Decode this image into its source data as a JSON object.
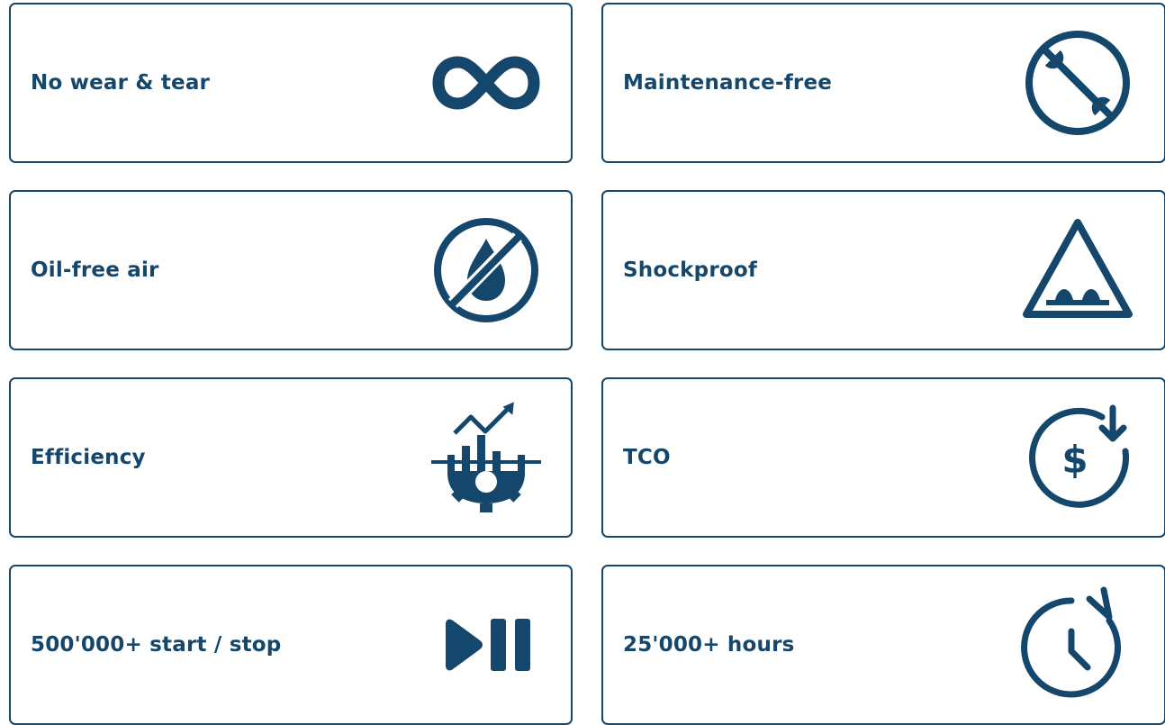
{
  "theme": {
    "accent": "#14476b",
    "background": "#ffffff"
  },
  "features": [
    {
      "label": "No wear & tear",
      "icon": "infinity-icon"
    },
    {
      "label": "Maintenance-free",
      "icon": "no-maintenance-icon"
    },
    {
      "label": "Oil-free air",
      "icon": "no-oil-drop-icon"
    },
    {
      "label": "Shockproof",
      "icon": "road-bump-warning-icon"
    },
    {
      "label": "Efficiency",
      "icon": "efficiency-gear-chart-icon"
    },
    {
      "label": "TCO",
      "icon": "cost-reduction-icon"
    },
    {
      "label": "500'000+ start / stop",
      "icon": "play-pause-icon"
    },
    {
      "label": "25'000+ hours",
      "icon": "clock-refresh-icon"
    }
  ]
}
